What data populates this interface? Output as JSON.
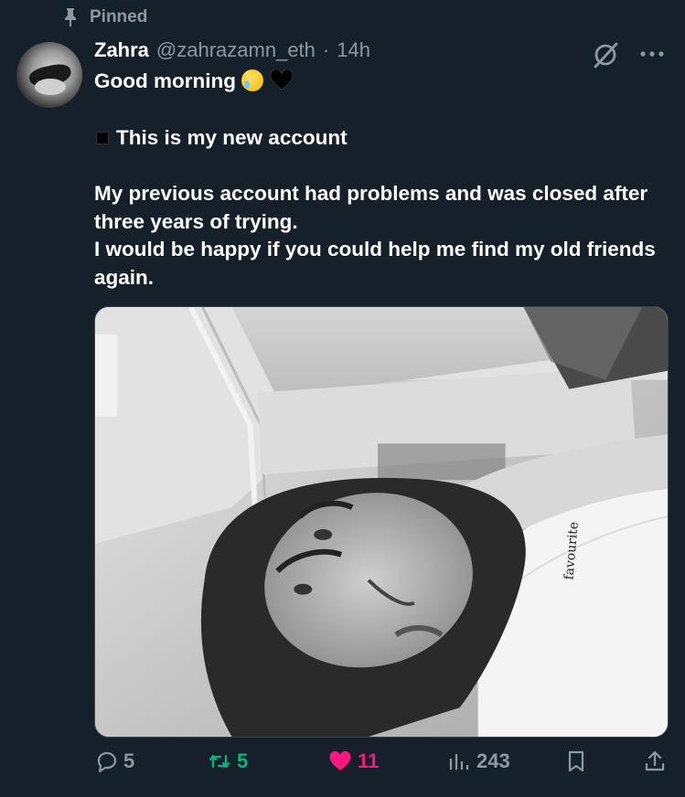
{
  "pinned": {
    "label": "Pinned"
  },
  "tweet": {
    "author_name": "Zahra",
    "author_handle": "@zahrazamn_eth",
    "separator": "·",
    "time": "14h",
    "text_line1": "Good morning",
    "text_line2": "This is my new account",
    "text_line3": "My previous account had problems and was closed after three years of trying.",
    "text_line4": "I would be happy if you could help me find my old friends again.",
    "photo_shirt_text": "favourite"
  },
  "actions": {
    "replies": "5",
    "reposts": "5",
    "likes": "11",
    "views": "243"
  },
  "icons": {
    "pin": "pin-icon",
    "grok": "grok-icon",
    "more": "more-icon",
    "reply": "reply-icon",
    "repost": "repost-icon",
    "like": "heart-icon",
    "views": "views-icon",
    "bookmark": "bookmark-icon",
    "share": "share-icon"
  },
  "colors": {
    "background": "#15202b",
    "muted": "#8b98a5",
    "repost": "#00ba7c",
    "like": "#f91880"
  }
}
